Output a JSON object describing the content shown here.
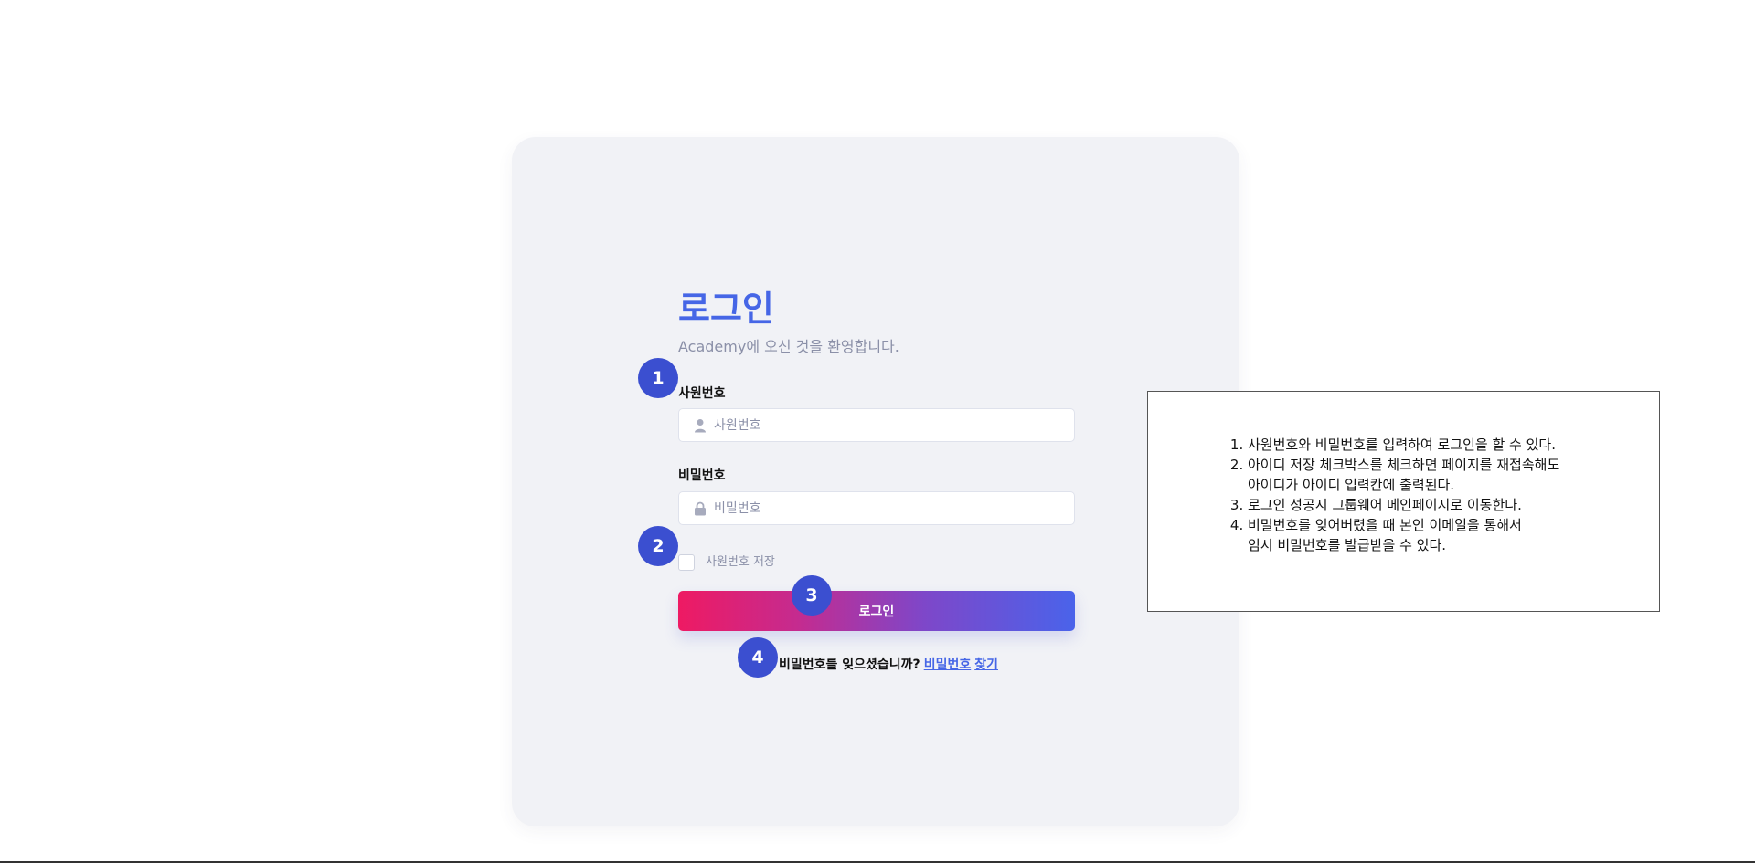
{
  "login": {
    "title": "로그인",
    "subtitle": "Academy에 오신 것을 환영합니다.",
    "employee_id_label": "사원번호",
    "employee_id_placeholder": "사원번호",
    "employee_id_icon": "user-icon",
    "password_label": "비밀번호",
    "password_placeholder": "비밀번호",
    "password_icon": "lock-icon",
    "remember_label": "사원번호 저장",
    "remember_checked": false,
    "login_button": "로그인",
    "forgot_prompt": "비밀번호를 잊으셨습니까?",
    "forgot_link_1": "비밀번호",
    "forgot_link_2": "찾기"
  },
  "badges": [
    "1",
    "2",
    "3",
    "4"
  ],
  "colors": {
    "accent": "#4666e6",
    "badge": "#3b4fd0",
    "button_gradient_start": "#ee1a63",
    "button_gradient_end": "#4a63ea",
    "card_background": "#f1f2f6"
  },
  "notes": [
    {
      "lines": [
        "사원번호와 비밀번호를 입력하여 로그인을 할 수 있다."
      ]
    },
    {
      "lines": [
        "아이디 저장 체크박스를 체크하면 페이지를 재접속해도",
        "아이디가 아이디 입력칸에 출력된다."
      ]
    },
    {
      "lines": [
        "로그인 성공시 그룹웨어 메인페이지로 이동한다."
      ]
    },
    {
      "lines": [
        "비밀번호를 잊어버렸을 때 본인 이메일을 통해서",
        "임시 비밀번호를 발급받을 수 있다."
      ]
    }
  ]
}
